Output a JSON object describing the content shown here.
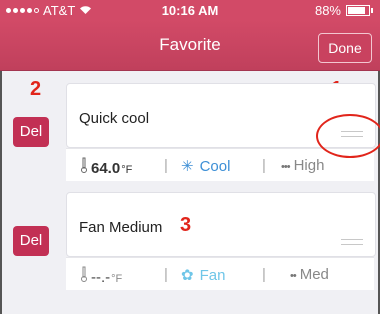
{
  "status_bar": {
    "carrier": "AT&T",
    "time": "10:16 AM",
    "battery": "88%"
  },
  "nav": {
    "title": "Favorite",
    "done_label": "Done"
  },
  "favorites": [
    {
      "del_label": "Del",
      "name": "Quick cool",
      "temperature": "64.0",
      "temp_unit": "°F",
      "mode": "Cool",
      "fan_speed": "High",
      "accent": "#3d8fd6"
    },
    {
      "del_label": "Del",
      "name": "Fan Medium",
      "temperature": "--.-",
      "temp_unit": "°F",
      "mode": "Fan",
      "fan_speed": "Med",
      "accent": "#6fc6e8"
    }
  ],
  "annotations": {
    "one": "1",
    "two": "2",
    "three": "3"
  },
  "colors": {
    "header": "#d24a67",
    "del_button": "#c23054",
    "annotation": "#e1251b"
  }
}
